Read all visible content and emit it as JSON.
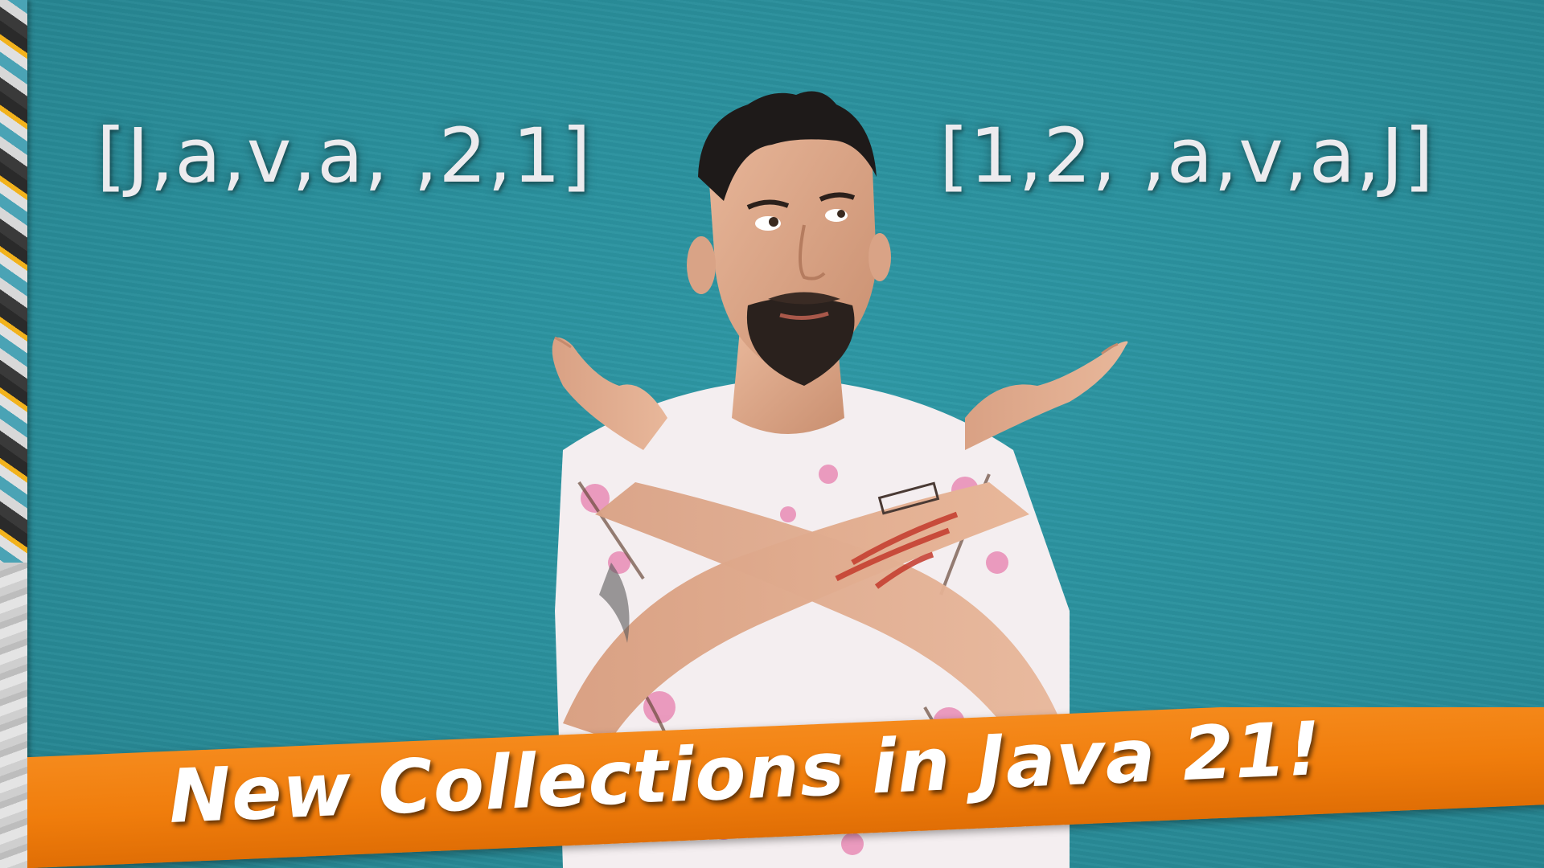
{
  "thumbnail": {
    "left_list_text": "[J,a,v,a, ,2,1]",
    "right_list_text": "[1,2, ,a,v,a,J]",
    "banner_title": "New Collections in Java 21!"
  },
  "colors": {
    "background": "#2a8f9c",
    "banner": "#f07d0c",
    "banner_text": "#ffffff",
    "list_text": "#ecebee"
  }
}
